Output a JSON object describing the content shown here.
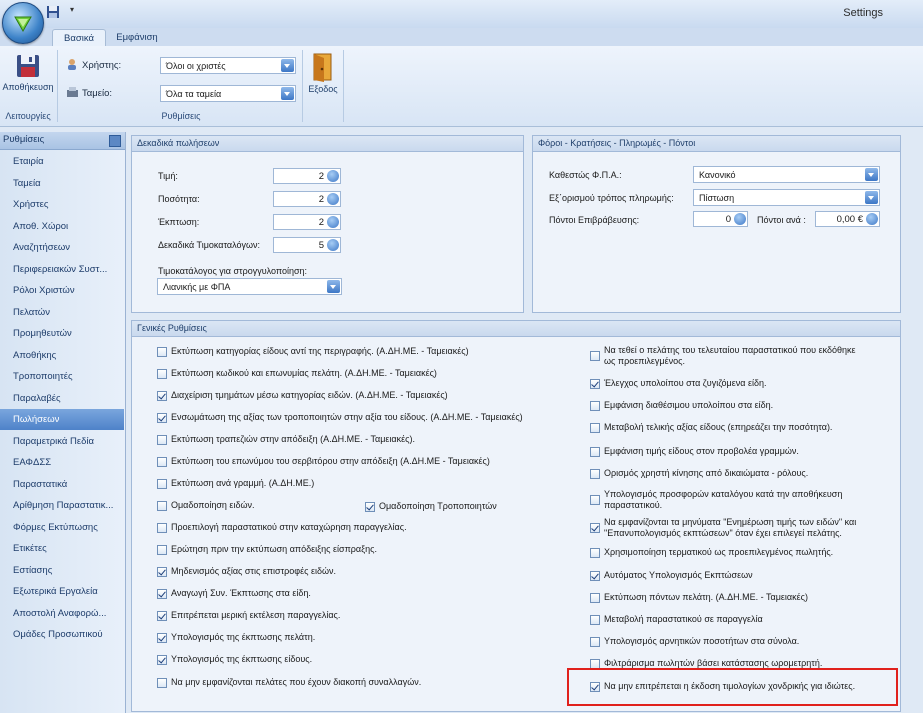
{
  "window": {
    "title": "Settings"
  },
  "tabs": [
    {
      "label": "Βασικά"
    },
    {
      "label": "Εμφάνιση"
    }
  ],
  "ribbon": {
    "save_label": "Αποθήκευση",
    "user_label": "Χρήστης:",
    "user_value": "Όλοι οι χριστές",
    "store_label": "Ταμείο:",
    "store_value": "Όλα τα ταμεία",
    "exit_label": "Εξοδος",
    "group_functions": "Λειτουργίες",
    "group_settings": "Ρυθμίσεις"
  },
  "sidebar": {
    "header": "Ρυθμίσεις",
    "items": [
      {
        "label": "Εταιρία"
      },
      {
        "label": "Ταμεία"
      },
      {
        "label": "Χρήστες"
      },
      {
        "label": "Αποθ. Χώροι"
      },
      {
        "label": "Αναζητήσεων"
      },
      {
        "label": "Περιφερειακών Συστ..."
      },
      {
        "label": "Ρόλοι Χριστών"
      },
      {
        "label": "Πελατών"
      },
      {
        "label": "Προμηθευτών"
      },
      {
        "label": "Αποθήκης"
      },
      {
        "label": "Τροποποιητές"
      },
      {
        "label": "Παραλαβές"
      },
      {
        "label": "Πωλήσεων"
      },
      {
        "label": "Παραμετρικά Πεδία"
      },
      {
        "label": "ΕΑΦΔΣΣ"
      },
      {
        "label": "Παραστατικά"
      },
      {
        "label": "Αρίθμηση Παραστατικ..."
      },
      {
        "label": "Φόρμες Εκτύπωσης"
      },
      {
        "label": "Ετικέτες"
      },
      {
        "label": "Εστίασης"
      },
      {
        "label": "Εξωτερικά Εργαλεία"
      },
      {
        "label": "Αποστολή Αναφορώ..."
      },
      {
        "label": "Ομάδες Προσωπικού"
      }
    ],
    "active_index": 12
  },
  "decimals": {
    "title": "Δεκαδικά πωλήσεων",
    "price_label": "Τιμή:",
    "price_value": "2",
    "qty_label": "Ποσότητα:",
    "qty_value": "2",
    "discount_label": "Έκπτωση:",
    "discount_value": "2",
    "pricelist_label": "Δεκαδικά Τιμοκαταλόγων:",
    "pricelist_value": "5",
    "rounding_label": "Τιμοκατάλογος για στρογγυλοποίηση:",
    "rounding_value": "Λιανικής με ΦΠΑ"
  },
  "taxes": {
    "title": "Φόροι - Κρατήσεις - Πληρωμές - Πόντοι",
    "vat_label": "Καθεστώς Φ.Π.Α.:",
    "vat_value": "Κανονικό",
    "payment_label": "Εξ΄ορισμού τρόπος πληρωμής:",
    "payment_value": "Πίστωση",
    "points_label": "Πόντοι Επιβράβευσης:",
    "points_value": "0",
    "points_per_label": "Πόντοι ανά :",
    "points_per_value": "0,00 €"
  },
  "general": {
    "title": "Γενικές Ρυθμίσεις",
    "left": [
      {
        "label": "Εκτύπωση κατηγορίας είδους αντί της περιγραφής. (Α.ΔΗ.ΜΕ. - Ταμειακές)",
        "checked": false
      },
      {
        "label": "Εκτύπωση κωδικού και επωνυμίας πελάτη. (Α.ΔΗ.ΜΕ. - Ταμειακές)",
        "checked": false
      },
      {
        "label": "Διαχείριση τμημάτων μέσω κατηγορίας ειδών. (Α.ΔΗ.ΜΕ. - Ταμειακές)",
        "checked": true
      },
      {
        "label": "Ενσωμάτωση της αξίας των τροποποιητών στην αξία του είδους. (Α.ΔΗ.ΜΕ. - Ταμειακές)",
        "checked": true
      },
      {
        "label": "Εκτύπωση τραπεζιών στην απόδειξη (Α.ΔΗ.ΜΕ. - Ταμειακές).",
        "checked": false
      },
      {
        "label": "Εκτύπωση του επωνύμου του σερβιτόρου στην απόδειξη (Α.ΔΗ.ΜΕ - Ταμειακές)",
        "checked": false
      },
      {
        "label": "Εκτύπωση ανά γραμμή. (Α.ΔΗ.ΜΕ.)",
        "checked": false
      },
      {
        "label": "Ομαδοποίηση ειδών.",
        "checked": false
      },
      {
        "label": "Προεπιλογή παραστατικού στην καταχώρηση παραγγελίας.",
        "checked": false
      },
      {
        "label": "Ερώτηση πριν την εκτύπωση απόδειξης είσπραξης.",
        "checked": false
      },
      {
        "label": "Μηδενισμός αξίας στις επιστροφές ειδών.",
        "checked": true
      },
      {
        "label": "Αναγωγή Συν. Έκπτωσης στα είδη.",
        "checked": true
      },
      {
        "label": "Επιτρέπεται μερική εκτέλεση παραγγελίας.",
        "checked": true
      },
      {
        "label": "Υπολογισμός της έκπτωσης πελάτη.",
        "checked": true
      },
      {
        "label": "Υπολογισμός της έκπτωσης είδους.",
        "checked": true
      },
      {
        "label": "Να μην εμφανίζονται πελάτες που έχουν διακοπή συναλλαγών.",
        "checked": false
      }
    ],
    "group_modifiers": {
      "label": "Ομαδοποίηση Τροποποιητών",
      "checked": true
    },
    "right": [
      {
        "label": "Να τεθεί ο πελάτης του τελευταίου παραστατικού που εκδόθηκε\nως προεπιλεγμένος.",
        "checked": false
      },
      {
        "label": "Έλεγχος υπολοίπου στα ζυγιζόμενα είδη.",
        "checked": true
      },
      {
        "label": "Εμφάνιση διαθέσιμου υπολοίπου στα είδη.",
        "checked": false
      },
      {
        "label": "Μεταβολή τελικής αξίας είδους (επηρεάζει την ποσότητα).",
        "checked": false
      },
      {
        "label": "Εμφάνιση τιμής είδους στον προβολέα γραμμών.",
        "checked": false
      },
      {
        "label": "Ορισμός χρηστή κίνησης από δικαιώματα - ρόλους.",
        "checked": false
      },
      {
        "label": "Υπολογισμός προσφορών καταλόγου κατά την αποθήκευση\nπαραστατικού.",
        "checked": false
      },
      {
        "label": "Να εμφανίζονται τα μηνύματα \"Ενημέρωση τιμής των ειδών\" και\n\"Επανυπολογισμός εκπτώσεων\" όταν έχει επιλεγεί πελάτης.",
        "checked": true
      },
      {
        "label": "Χρησιμοποίηση τερματικού ως προεπιλεγμένος πωλητής.",
        "checked": false
      },
      {
        "label": "Αυτόματος Υπολογισμός Εκπτώσεων",
        "checked": true
      },
      {
        "label": "Εκτύπωση πόντων πελάτη. (Α.ΔΗ.ΜΕ. - Ταμειακές)",
        "checked": false
      },
      {
        "label": "Μεταβολή παραστατικού σε παραγγελία",
        "checked": false
      },
      {
        "label": "Υπολογισμός αρνητικών ποσοτήτων στα σύνολα.",
        "checked": false
      },
      {
        "label": "Φιλτράρισμα πωλητών βάσει κατάστασης ωρομετρητή.",
        "checked": false
      },
      {
        "label": "Να μην επιτρέπεται η έκδοση τιμολογίων χονδρικής για ιδιώτες.",
        "checked": true
      }
    ]
  },
  "colors": {
    "accent": "#4e82c9",
    "highlight_box": "#e0201c"
  }
}
